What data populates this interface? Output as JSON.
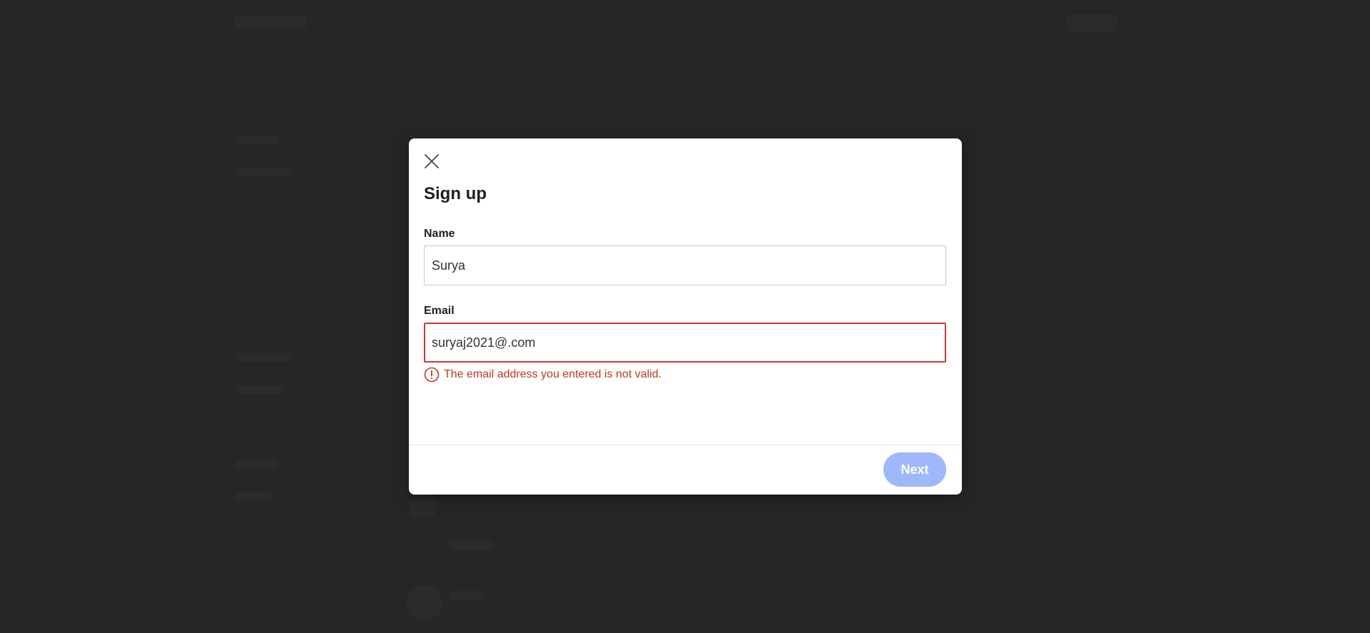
{
  "modal": {
    "title": "Sign up",
    "close_icon": "close-icon"
  },
  "form": {
    "name": {
      "label": "Name",
      "value": "Surya"
    },
    "email": {
      "label": "Email",
      "value": "suryaj2021@.com",
      "error": "The email address you entered is not valid.",
      "error_icon": "exclamation-circle-icon"
    }
  },
  "footer": {
    "next_label": "Next",
    "next_enabled": false
  },
  "colors": {
    "error": "#c4381c",
    "error_border": "#d13438",
    "next_disabled": "#9fb8fb",
    "backdrop": "#2b2b2b"
  }
}
